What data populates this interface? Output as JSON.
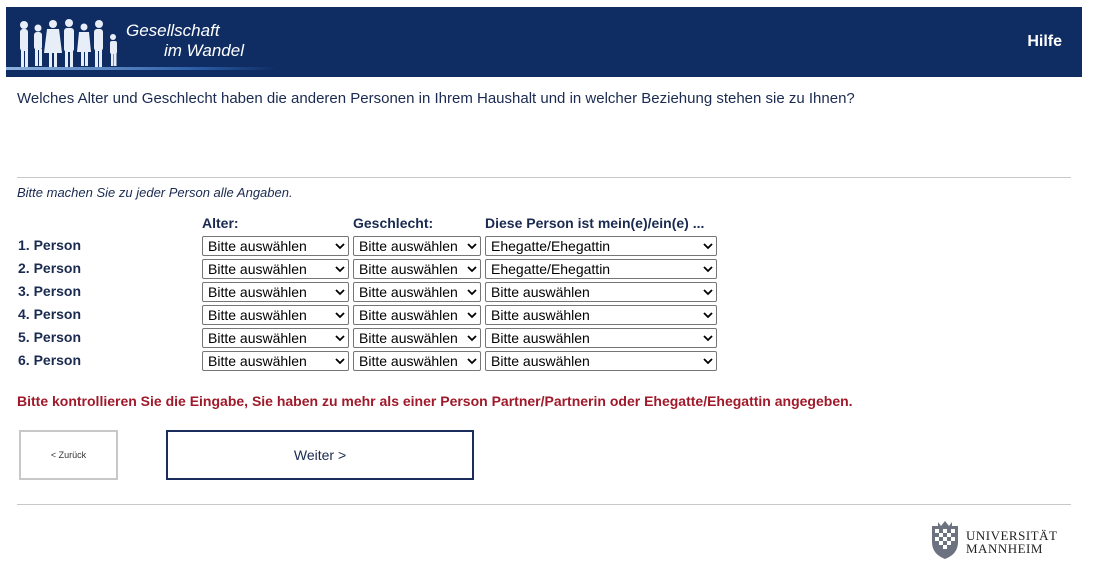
{
  "header": {
    "logo_line1": "Gesellschaft",
    "logo_line2": "im Wandel",
    "help": "Hilfe",
    "background": "#0f2d63"
  },
  "question": "Welches Alter und Geschlecht haben die anderen Personen in Ihrem Haushalt und in welcher Beziehung stehen sie zu Ihnen?",
  "instruction": "Bitte machen Sie zu jeder Person alle Angaben.",
  "columns": {
    "age": "Alter:",
    "gender": "Geschlecht:",
    "relation": "Diese Person ist mein(e)/ein(e) ..."
  },
  "persons": [
    {
      "label": "1. Person",
      "age": "Bitte auswählen",
      "gender": "Bitte auswählen",
      "relation": "Ehegatte/Ehegattin"
    },
    {
      "label": "2. Person",
      "age": "Bitte auswählen",
      "gender": "Bitte auswählen",
      "relation": "Ehegatte/Ehegattin"
    },
    {
      "label": "3. Person",
      "age": "Bitte auswählen",
      "gender": "Bitte auswählen",
      "relation": "Bitte auswählen"
    },
    {
      "label": "4. Person",
      "age": "Bitte auswählen",
      "gender": "Bitte auswählen",
      "relation": "Bitte auswählen"
    },
    {
      "label": "5. Person",
      "age": "Bitte auswählen",
      "gender": "Bitte auswählen",
      "relation": "Bitte auswählen"
    },
    {
      "label": "6. Person",
      "age": "Bitte auswählen",
      "gender": "Bitte auswählen",
      "relation": "Bitte auswählen"
    }
  ],
  "error": "Bitte kontrollieren Sie die Eingabe, Sie haben zu mehr als einer Person Partner/Partnerin oder Ehegatte/Ehegattin angegeben.",
  "buttons": {
    "back": "< Zurück",
    "next": "Weiter >"
  },
  "footer": {
    "uni_line1": "UNIVERSITÄT",
    "uni_line2": "MANNHEIM"
  },
  "colors": {
    "error": "#a0192a",
    "text": "#1a2a50"
  }
}
